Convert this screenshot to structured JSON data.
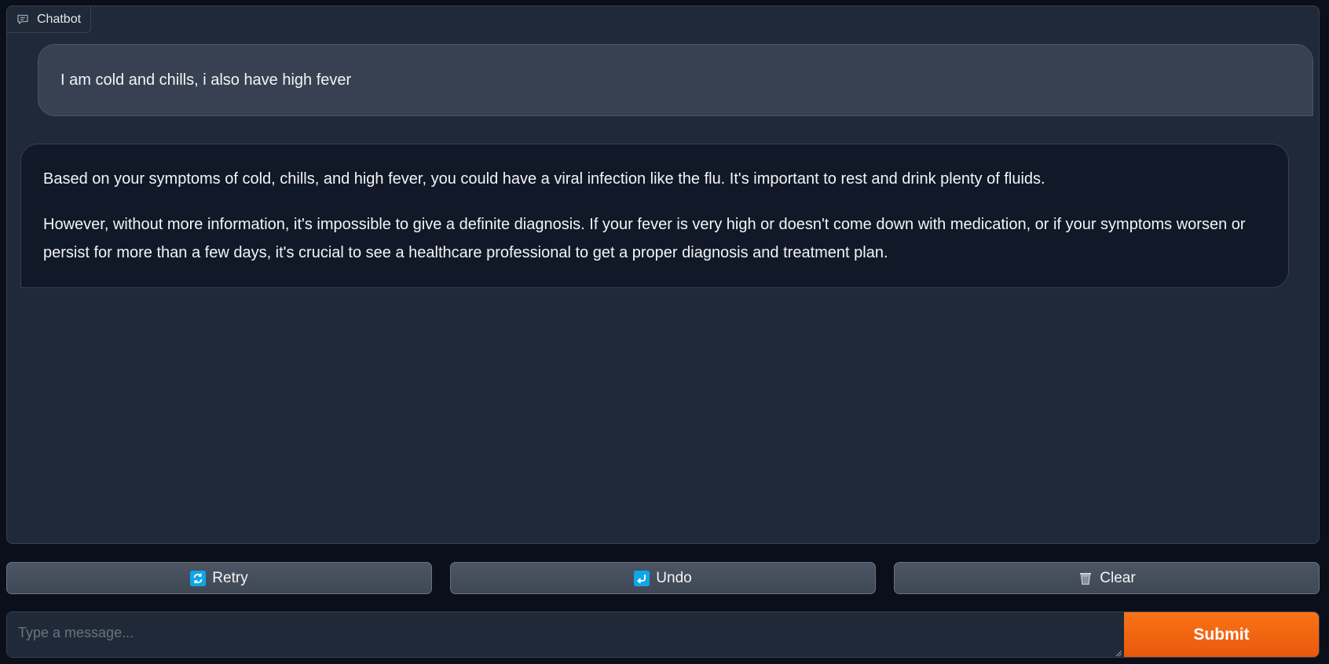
{
  "chatbot": {
    "label": "Chatbot",
    "label_icon": "chat-bubble-icon",
    "messages": [
      {
        "role": "user",
        "text": "I am cold and chills, i also have high fever"
      },
      {
        "role": "assistant",
        "paragraphs": [
          "Based on your symptoms of cold, chills, and high fever, you could have a viral infection like the flu. It's important to rest and drink plenty of fluids.",
          "However, without more information, it's impossible to give a definite diagnosis. If your fever is very high or doesn't come down with medication, or if your symptoms worsen or persist for more than a few days, it's crucial to see a healthcare professional to get a proper diagnosis and treatment plan."
        ]
      }
    ]
  },
  "actions": {
    "retry": {
      "label": "Retry",
      "icon": "retry-icon"
    },
    "undo": {
      "label": "Undo",
      "icon": "undo-icon"
    },
    "clear": {
      "label": "Clear",
      "icon": "trash-icon"
    }
  },
  "composer": {
    "placeholder": "Type a message...",
    "value": "",
    "submit_label": "Submit"
  },
  "colors": {
    "background": "#0b0f19",
    "panel": "#1f2937",
    "accent": "#f97316",
    "icon_blue": "#0ea5e9"
  }
}
